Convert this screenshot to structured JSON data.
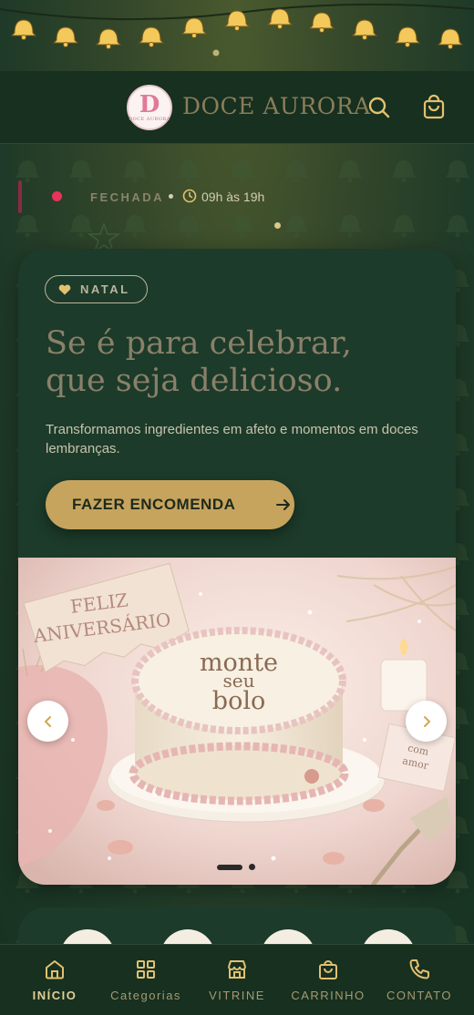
{
  "header": {
    "brand": "DOCE AURORA",
    "logo_monogram": "D",
    "logo_small_text": "DOCE AURORA"
  },
  "status": {
    "label": "FECHADA",
    "hours": "09h às 19h",
    "status_color": "#e8335a"
  },
  "hero": {
    "tag": "NATAL",
    "headline_line1": "Se é para celebrar,",
    "headline_line2": "que seja delicioso.",
    "subtext": "Transformamos ingredientes em afeto e momentos em doces lembranças.",
    "cta_label": "FAZER ENCOMENDA"
  },
  "slide": {
    "banner_line1": "FELIZ",
    "banner_line2": "ANIVERSÁRIO",
    "cake_line1": "monte",
    "cake_line2": "seu",
    "cake_line3": "bolo",
    "card_line1": "com",
    "card_line2": "amor",
    "current_slide": 1,
    "total_slides": 2
  },
  "bottom_nav": {
    "items": [
      {
        "label": "INÍCIO",
        "icon": "home-icon",
        "active": true
      },
      {
        "label": "Categorias",
        "icon": "grid-icon",
        "active": false
      },
      {
        "label": "VITRINE",
        "icon": "store-icon",
        "active": false
      },
      {
        "label": "CARRINHO",
        "icon": "bag-icon",
        "active": false
      },
      {
        "label": "CONTATO",
        "icon": "phone-icon",
        "active": false
      }
    ]
  },
  "colors": {
    "background": "#1e3a27",
    "card": "#1c3b2a",
    "accent_gold": "#c6a45e",
    "header": "#17301f"
  }
}
